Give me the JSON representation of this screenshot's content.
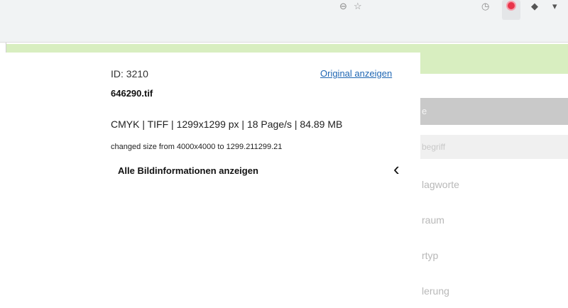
{
  "browser": {
    "icons": [
      "zoom-icon",
      "bookmark-star-icon",
      "history-icon",
      "extension-red-icon",
      "puzzle-icon"
    ]
  },
  "side_menu": {
    "active_item": "e",
    "search_placeholder": "begriff",
    "items": [
      "lagworte",
      "raum",
      "rtyp",
      "lerung"
    ]
  },
  "image_info": {
    "id": "ID: 3210",
    "original_link": "Original anzeigen",
    "filename": "646290.tif",
    "meta": "CMYK | TIFF | 1299x1299 px | 18 Page/s | 84.89 MB",
    "note": "changed size from 4000x4000 to 1299.211299.21",
    "show_all": "Alle Bildinformationen anzeigen"
  },
  "colors": {
    "notice_green": "#d8eec0",
    "link_blue": "#1f66b3",
    "menu_active": "#c9c9c9"
  }
}
